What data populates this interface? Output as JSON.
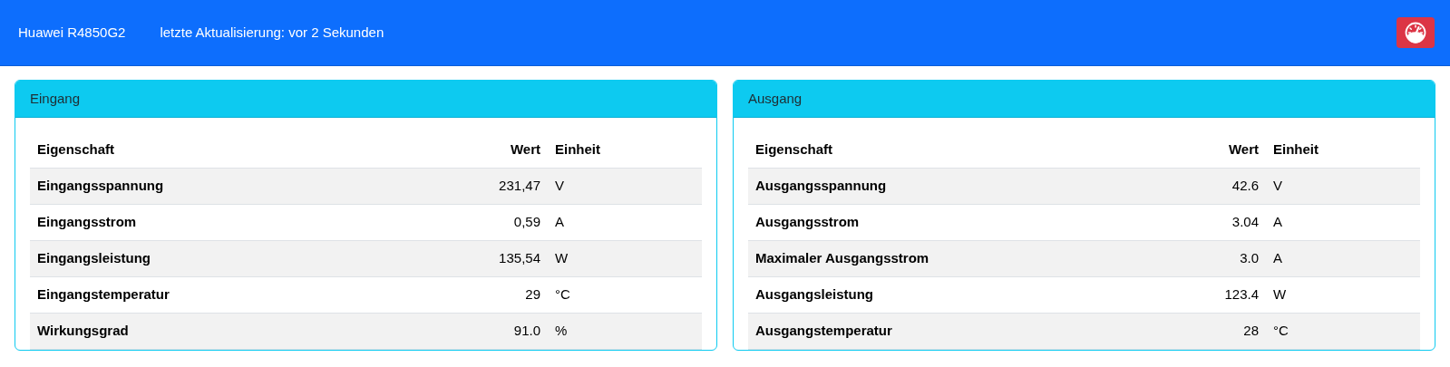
{
  "navbar": {
    "brand": "Huawei R4850G2",
    "status": "letzte Aktualisierung: vor 2 Sekunden"
  },
  "cards": [
    {
      "title": "Eingang",
      "columns": [
        "Eigenschaft",
        "Wert",
        "Einheit"
      ],
      "rows": [
        {
          "property": "Eingangsspannung",
          "value": "231,47",
          "unit": "V"
        },
        {
          "property": "Eingangsstrom",
          "value": "0,59",
          "unit": "A"
        },
        {
          "property": "Eingangsleistung",
          "value": "135,54",
          "unit": "W"
        },
        {
          "property": "Eingangstemperatur",
          "value": "29",
          "unit": "°C"
        },
        {
          "property": "Wirkungsgrad",
          "value": "91.0",
          "unit": "%"
        }
      ]
    },
    {
      "title": "Ausgang",
      "columns": [
        "Eigenschaft",
        "Wert",
        "Einheit"
      ],
      "rows": [
        {
          "property": "Ausgangsspannung",
          "value": "42.6",
          "unit": "V"
        },
        {
          "property": "Ausgangsstrom",
          "value": "3.04",
          "unit": "A"
        },
        {
          "property": "Maximaler Ausgangsstrom",
          "value": "3.0",
          "unit": "A"
        },
        {
          "property": "Ausgangsleistung",
          "value": "123.4",
          "unit": "W"
        },
        {
          "property": "Ausgangstemperatur",
          "value": "28",
          "unit": "°C"
        }
      ]
    }
  ]
}
